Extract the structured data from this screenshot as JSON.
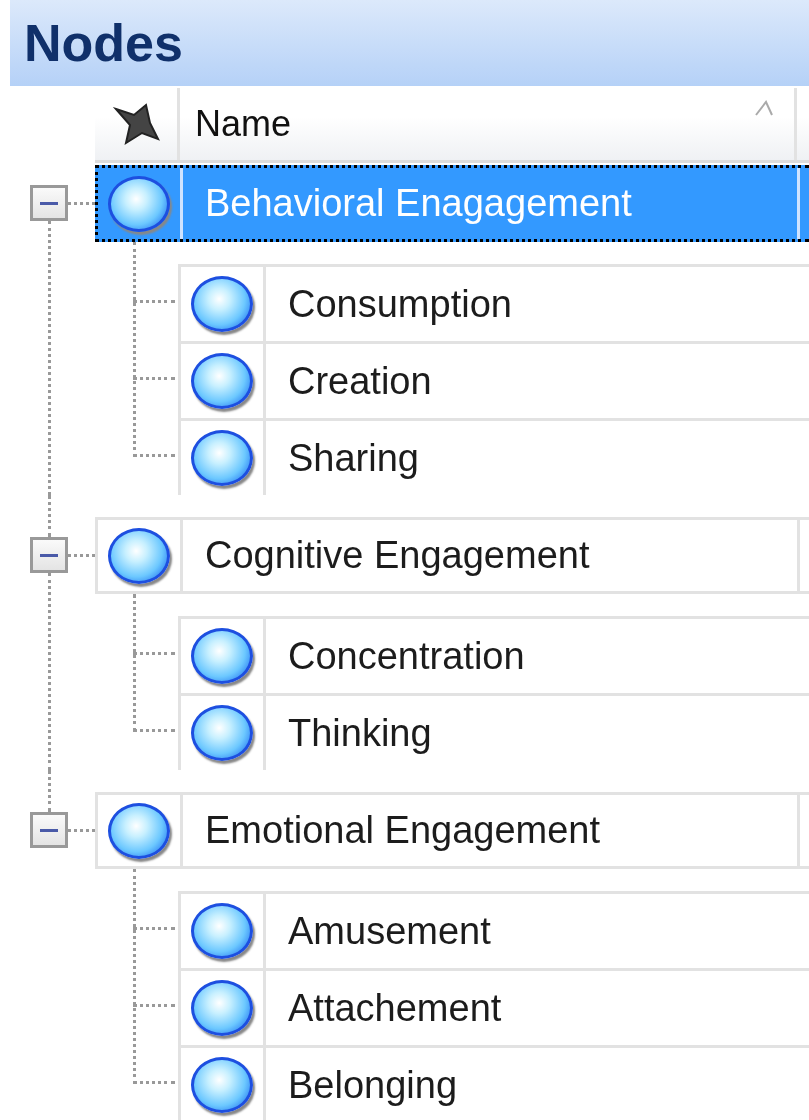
{
  "panel": {
    "title": "Nodes"
  },
  "table": {
    "columns": [
      {
        "label": "Name",
        "sorted": true
      }
    ]
  },
  "nodes": [
    {
      "name": "Behavioral Enagagement",
      "selected": true,
      "expanded": true,
      "children": [
        {
          "name": "Consumption",
          "selected": false
        },
        {
          "name": "Creation",
          "selected": false
        },
        {
          "name": "Sharing",
          "selected": false
        }
      ]
    },
    {
      "name": "Cognitive Engagement",
      "selected": false,
      "expanded": true,
      "children": [
        {
          "name": "Concentration",
          "selected": false
        },
        {
          "name": "Thinking",
          "selected": false
        }
      ]
    },
    {
      "name": "Emotional Engagement",
      "selected": false,
      "expanded": true,
      "children": [
        {
          "name": "Amusement",
          "selected": false
        },
        {
          "name": "Attachement",
          "selected": false
        },
        {
          "name": "Belonging",
          "selected": false
        }
      ]
    }
  ]
}
